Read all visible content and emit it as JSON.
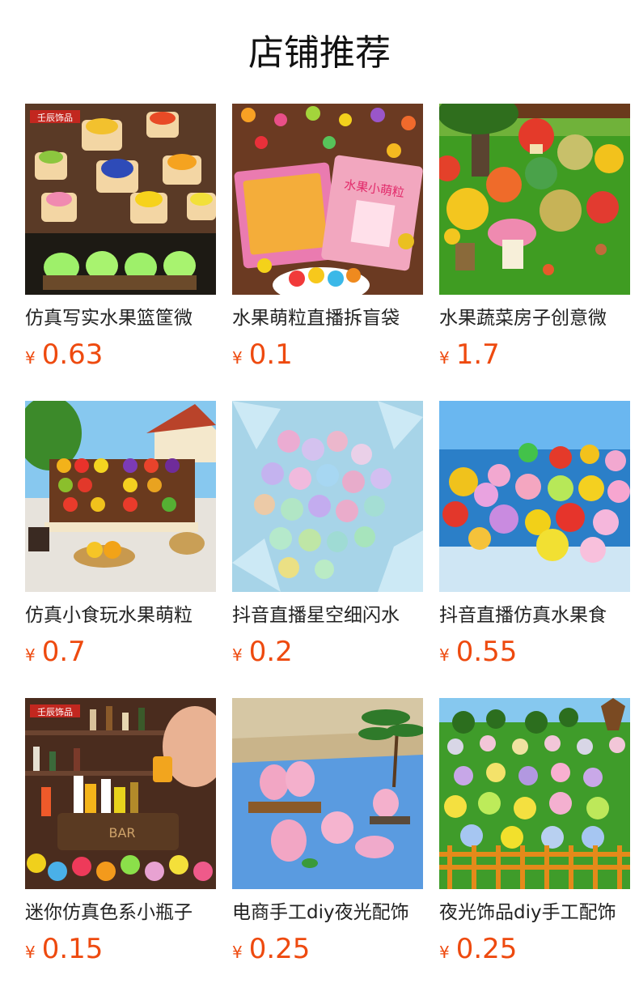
{
  "page": {
    "title": "店铺推荐"
  },
  "currency_symbol": "¥",
  "products": [
    {
      "name": "仿真写实水果篮筐微",
      "price": "0.63",
      "brand_watermark": "壬辰饰品"
    },
    {
      "name": "水果萌粒直播拆盲袋",
      "price": "0.1",
      "packaging_text": "水果小萌粒"
    },
    {
      "name": "水果蔬菜房子创意微",
      "price": "1.7"
    },
    {
      "name": "仿真小食玩水果萌粒",
      "price": "0.7"
    },
    {
      "name": "抖音直播星空细闪水",
      "price": "0.2"
    },
    {
      "name": "抖音直播仿真水果食",
      "price": "0.55"
    },
    {
      "name": "迷你仿真色系小瓶子",
      "price": "0.15",
      "brand_watermark": "壬辰饰品",
      "sign_text": "BAR"
    },
    {
      "name": "电商手工diy夜光配饰",
      "price": "0.25"
    },
    {
      "name": "夜光饰品diy手工配饰",
      "price": "0.25"
    }
  ],
  "colors": {
    "price": "#ee4a0f",
    "title": "#111111",
    "text": "#222222"
  }
}
